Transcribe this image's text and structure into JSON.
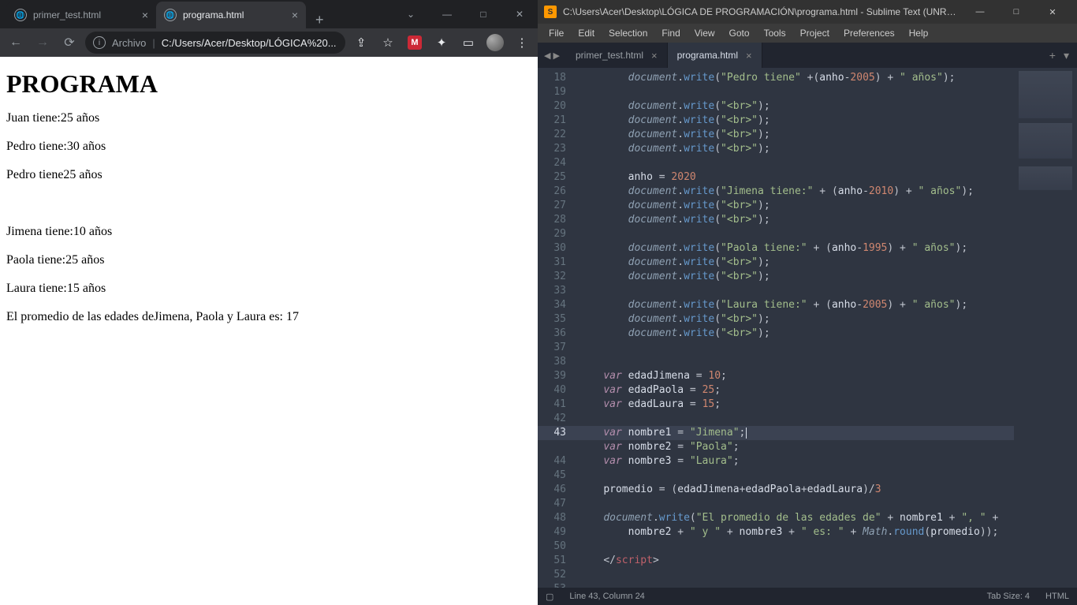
{
  "chrome": {
    "tabs": [
      {
        "title": "primer_test.html",
        "active": false
      },
      {
        "title": "programa.html",
        "active": true
      }
    ],
    "window_controls": {
      "min": "—",
      "max": "□",
      "close": "✕",
      "dropdown": "⌄"
    },
    "toolbar": {
      "back": "←",
      "forward": "→",
      "reload": "⟳",
      "addr_label": "Archivo",
      "addr_path": "C:/Users/Acer/Desktop/LÓGICA%20...",
      "share": "⇪",
      "star": "☆",
      "puzzle": "✦",
      "books": "▭",
      "menu": "⋮"
    },
    "page": {
      "h1": "PROGRAMA",
      "lines": [
        "Juan tiene:25 años",
        "Pedro tiene:30 años",
        "Pedro tiene25 años",
        "",
        "Jimena tiene:10 años",
        "Paola tiene:25 años",
        "Laura tiene:15 años",
        "El promedio de las edades deJimena, Paola y Laura es: 17"
      ]
    }
  },
  "sublime": {
    "title": "C:\\Users\\Acer\\Desktop\\LÓGICA DE PROGRAMACIÓN\\programa.html - Sublime Text (UNREGIS...",
    "menu": [
      "File",
      "Edit",
      "Selection",
      "Find",
      "View",
      "Goto",
      "Tools",
      "Project",
      "Preferences",
      "Help"
    ],
    "tabs": [
      {
        "title": "primer_test.html",
        "active": false
      },
      {
        "title": "programa.html",
        "active": true
      }
    ],
    "code_first_line": 18,
    "active_line": 43,
    "code": [
      [
        [
          "        ",
          ""
        ],
        [
          "document",
          "obj"
        ],
        [
          ".",
          "pun"
        ],
        [
          "write",
          "fn"
        ],
        [
          "(",
          "pun"
        ],
        [
          "\"Pedro tiene\"",
          "str"
        ],
        [
          " ",
          "op"
        ],
        [
          "+",
          "op"
        ],
        [
          "(",
          "pun"
        ],
        [
          "anho",
          "var"
        ],
        [
          "-",
          "op"
        ],
        [
          "2005",
          "num"
        ],
        [
          ")",
          "pun"
        ],
        [
          " ",
          "op"
        ],
        [
          "+",
          "op"
        ],
        [
          " ",
          "op"
        ],
        [
          "\" años\"",
          "str"
        ],
        [
          ");",
          "pun"
        ]
      ],
      [],
      [
        [
          "        ",
          ""
        ],
        [
          "document",
          "obj"
        ],
        [
          ".",
          "pun"
        ],
        [
          "write",
          "fn"
        ],
        [
          "(",
          "pun"
        ],
        [
          "\"<br>\"",
          "str"
        ],
        [
          ");",
          "pun"
        ]
      ],
      [
        [
          "        ",
          ""
        ],
        [
          "document",
          "obj"
        ],
        [
          ".",
          "pun"
        ],
        [
          "write",
          "fn"
        ],
        [
          "(",
          "pun"
        ],
        [
          "\"<br>\"",
          "str"
        ],
        [
          ");",
          "pun"
        ]
      ],
      [
        [
          "        ",
          ""
        ],
        [
          "document",
          "obj"
        ],
        [
          ".",
          "pun"
        ],
        [
          "write",
          "fn"
        ],
        [
          "(",
          "pun"
        ],
        [
          "\"<br>\"",
          "str"
        ],
        [
          ");",
          "pun"
        ]
      ],
      [
        [
          "        ",
          ""
        ],
        [
          "document",
          "obj"
        ],
        [
          ".",
          "pun"
        ],
        [
          "write",
          "fn"
        ],
        [
          "(",
          "pun"
        ],
        [
          "\"<br>\"",
          "str"
        ],
        [
          ");",
          "pun"
        ]
      ],
      [],
      [
        [
          "        ",
          ""
        ],
        [
          "anho",
          "var"
        ],
        [
          " ",
          "op"
        ],
        [
          "=",
          "op"
        ],
        [
          " ",
          "op"
        ],
        [
          "2020",
          "num"
        ]
      ],
      [
        [
          "        ",
          ""
        ],
        [
          "document",
          "obj"
        ],
        [
          ".",
          "pun"
        ],
        [
          "write",
          "fn"
        ],
        [
          "(",
          "pun"
        ],
        [
          "\"Jimena tiene:\"",
          "str"
        ],
        [
          " ",
          "op"
        ],
        [
          "+",
          "op"
        ],
        [
          " ",
          "op"
        ],
        [
          "(",
          "pun"
        ],
        [
          "anho",
          "var"
        ],
        [
          "-",
          "op"
        ],
        [
          "2010",
          "num"
        ],
        [
          ")",
          "pun"
        ],
        [
          " ",
          "op"
        ],
        [
          "+",
          "op"
        ],
        [
          " ",
          "op"
        ],
        [
          "\" años\"",
          "str"
        ],
        [
          ");",
          "pun"
        ]
      ],
      [
        [
          "        ",
          ""
        ],
        [
          "document",
          "obj"
        ],
        [
          ".",
          "pun"
        ],
        [
          "write",
          "fn"
        ],
        [
          "(",
          "pun"
        ],
        [
          "\"<br>\"",
          "str"
        ],
        [
          ");",
          "pun"
        ]
      ],
      [
        [
          "        ",
          ""
        ],
        [
          "document",
          "obj"
        ],
        [
          ".",
          "pun"
        ],
        [
          "write",
          "fn"
        ],
        [
          "(",
          "pun"
        ],
        [
          "\"<br>\"",
          "str"
        ],
        [
          ");",
          "pun"
        ]
      ],
      [],
      [
        [
          "        ",
          ""
        ],
        [
          "document",
          "obj"
        ],
        [
          ".",
          "pun"
        ],
        [
          "write",
          "fn"
        ],
        [
          "(",
          "pun"
        ],
        [
          "\"Paola tiene:\"",
          "str"
        ],
        [
          " ",
          "op"
        ],
        [
          "+",
          "op"
        ],
        [
          " ",
          "op"
        ],
        [
          "(",
          "pun"
        ],
        [
          "anho",
          "var"
        ],
        [
          "-",
          "op"
        ],
        [
          "1995",
          "num"
        ],
        [
          ")",
          "pun"
        ],
        [
          " ",
          "op"
        ],
        [
          "+",
          "op"
        ],
        [
          " ",
          "op"
        ],
        [
          "\" años\"",
          "str"
        ],
        [
          ");",
          "pun"
        ]
      ],
      [
        [
          "        ",
          ""
        ],
        [
          "document",
          "obj"
        ],
        [
          ".",
          "pun"
        ],
        [
          "write",
          "fn"
        ],
        [
          "(",
          "pun"
        ],
        [
          "\"<br>\"",
          "str"
        ],
        [
          ");",
          "pun"
        ]
      ],
      [
        [
          "        ",
          ""
        ],
        [
          "document",
          "obj"
        ],
        [
          ".",
          "pun"
        ],
        [
          "write",
          "fn"
        ],
        [
          "(",
          "pun"
        ],
        [
          "\"<br>\"",
          "str"
        ],
        [
          ");",
          "pun"
        ]
      ],
      [],
      [
        [
          "        ",
          ""
        ],
        [
          "document",
          "obj"
        ],
        [
          ".",
          "pun"
        ],
        [
          "write",
          "fn"
        ],
        [
          "(",
          "pun"
        ],
        [
          "\"Laura tiene:\"",
          "str"
        ],
        [
          " ",
          "op"
        ],
        [
          "+",
          "op"
        ],
        [
          " ",
          "op"
        ],
        [
          "(",
          "pun"
        ],
        [
          "anho",
          "var"
        ],
        [
          "-",
          "op"
        ],
        [
          "2005",
          "num"
        ],
        [
          ")",
          "pun"
        ],
        [
          " ",
          "op"
        ],
        [
          "+",
          "op"
        ],
        [
          " ",
          "op"
        ],
        [
          "\" años\"",
          "str"
        ],
        [
          ");",
          "pun"
        ]
      ],
      [
        [
          "        ",
          ""
        ],
        [
          "document",
          "obj"
        ],
        [
          ".",
          "pun"
        ],
        [
          "write",
          "fn"
        ],
        [
          "(",
          "pun"
        ],
        [
          "\"<br>\"",
          "str"
        ],
        [
          ");",
          "pun"
        ]
      ],
      [
        [
          "        ",
          ""
        ],
        [
          "document",
          "obj"
        ],
        [
          ".",
          "pun"
        ],
        [
          "write",
          "fn"
        ],
        [
          "(",
          "pun"
        ],
        [
          "\"<br>\"",
          "str"
        ],
        [
          ");",
          "pun"
        ]
      ],
      [],
      [],
      [
        [
          "    ",
          ""
        ],
        [
          "var",
          "kw"
        ],
        [
          " ",
          "op"
        ],
        [
          "edadJimena",
          "var"
        ],
        [
          " ",
          "op"
        ],
        [
          "=",
          "op"
        ],
        [
          " ",
          "op"
        ],
        [
          "10",
          "num"
        ],
        [
          ";",
          "pun"
        ]
      ],
      [
        [
          "    ",
          ""
        ],
        [
          "var",
          "kw"
        ],
        [
          " ",
          "op"
        ],
        [
          "edadPaola",
          "var"
        ],
        [
          " ",
          "op"
        ],
        [
          "=",
          "op"
        ],
        [
          " ",
          "op"
        ],
        [
          "25",
          "num"
        ],
        [
          ";",
          "pun"
        ]
      ],
      [
        [
          "    ",
          ""
        ],
        [
          "var",
          "kw"
        ],
        [
          " ",
          "op"
        ],
        [
          "edadLaura",
          "var"
        ],
        [
          " ",
          "op"
        ],
        [
          "=",
          "op"
        ],
        [
          " ",
          "op"
        ],
        [
          "15",
          "num"
        ],
        [
          ";",
          "pun"
        ]
      ],
      [],
      [
        [
          "    ",
          ""
        ],
        [
          "var",
          "kw"
        ],
        [
          " ",
          "op"
        ],
        [
          "nombre1",
          "var"
        ],
        [
          " ",
          "op"
        ],
        [
          "=",
          "op"
        ],
        [
          " ",
          "op"
        ],
        [
          "\"Jimena\"",
          "str"
        ],
        [
          ";",
          "pun"
        ]
      ],
      [
        [
          "    ",
          ""
        ],
        [
          "var",
          "kw"
        ],
        [
          " ",
          "op"
        ],
        [
          "nombre2",
          "var"
        ],
        [
          " ",
          "op"
        ],
        [
          "=",
          "op"
        ],
        [
          " ",
          "op"
        ],
        [
          "\"Paola\"",
          "str"
        ],
        [
          ";",
          "pun"
        ]
      ],
      [
        [
          "    ",
          ""
        ],
        [
          "var",
          "kw"
        ],
        [
          " ",
          "op"
        ],
        [
          "nombre3",
          "var"
        ],
        [
          " ",
          "op"
        ],
        [
          "=",
          "op"
        ],
        [
          " ",
          "op"
        ],
        [
          "\"Laura\"",
          "str"
        ],
        [
          ";",
          "pun"
        ]
      ],
      [],
      [
        [
          "    ",
          ""
        ],
        [
          "promedio",
          "var"
        ],
        [
          " ",
          "op"
        ],
        [
          "=",
          "op"
        ],
        [
          " ",
          "op"
        ],
        [
          "(",
          "pun"
        ],
        [
          "edadJimena",
          "var"
        ],
        [
          "+",
          "op"
        ],
        [
          "edadPaola",
          "var"
        ],
        [
          "+",
          "op"
        ],
        [
          "edadLaura",
          "var"
        ],
        [
          ")",
          "pun"
        ],
        [
          "/",
          "op"
        ],
        [
          "3",
          "num"
        ]
      ],
      [],
      [
        [
          "    ",
          ""
        ],
        [
          "document",
          "obj"
        ],
        [
          ".",
          "pun"
        ],
        [
          "write",
          "fn"
        ],
        [
          "(",
          "pun"
        ],
        [
          "\"El promedio de las edades de\"",
          "str"
        ],
        [
          " ",
          "op"
        ],
        [
          "+",
          "op"
        ],
        [
          " ",
          "op"
        ],
        [
          "nombre1",
          "var"
        ],
        [
          " ",
          "op"
        ],
        [
          "+",
          "op"
        ],
        [
          " ",
          "op"
        ],
        [
          "\", \"",
          "str"
        ],
        [
          " ",
          "op"
        ],
        [
          "+",
          "op"
        ]
      ],
      [
        [
          "        ",
          ""
        ],
        [
          "nombre2",
          "var"
        ],
        [
          " ",
          "op"
        ],
        [
          "+",
          "op"
        ],
        [
          " ",
          "op"
        ],
        [
          "\" y \"",
          "str"
        ],
        [
          " ",
          "op"
        ],
        [
          "+",
          "op"
        ],
        [
          " ",
          "op"
        ],
        [
          "nombre3",
          "var"
        ],
        [
          " ",
          "op"
        ],
        [
          "+",
          "op"
        ],
        [
          " ",
          "op"
        ],
        [
          "\" es: \"",
          "str"
        ],
        [
          " ",
          "op"
        ],
        [
          "+",
          "op"
        ],
        [
          " ",
          "op"
        ],
        [
          "Math",
          "obj"
        ],
        [
          ".",
          "pun"
        ],
        [
          "round",
          "fn"
        ],
        [
          "(",
          "pun"
        ],
        [
          "promedio",
          "var"
        ],
        [
          "));",
          "pun"
        ]
      ],
      [],
      [
        [
          "    ",
          ""
        ],
        [
          "</",
          "pun"
        ],
        [
          "script",
          "tag"
        ],
        [
          ">",
          "pun"
        ]
      ],
      []
    ],
    "status": {
      "left_icon": "▢",
      "pos": "Line 43, Column 24",
      "tab": "Tab Size: 4",
      "lang": "HTML"
    }
  }
}
